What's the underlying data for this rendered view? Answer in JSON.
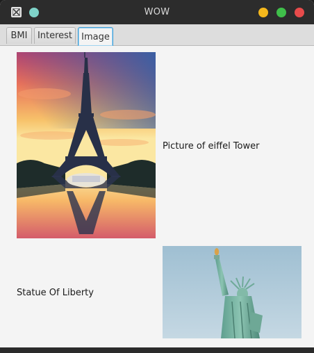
{
  "window": {
    "title": "WOW",
    "icon": "app-logo-icon",
    "controls": [
      "minimize-button",
      "maximize-button",
      "close-button"
    ],
    "colors": {
      "minimize": "#f5b81c",
      "maximize": "#3fbf4a",
      "close": "#e84b4b"
    }
  },
  "tabs": [
    {
      "label": "BMI",
      "selected": false
    },
    {
      "label": "Interest",
      "selected": false
    },
    {
      "label": "Image",
      "selected": true
    }
  ],
  "content": {
    "eiffel": {
      "caption": "Picture of eiffel Tower"
    },
    "liberty": {
      "caption": "Statue Of Liberty"
    }
  }
}
